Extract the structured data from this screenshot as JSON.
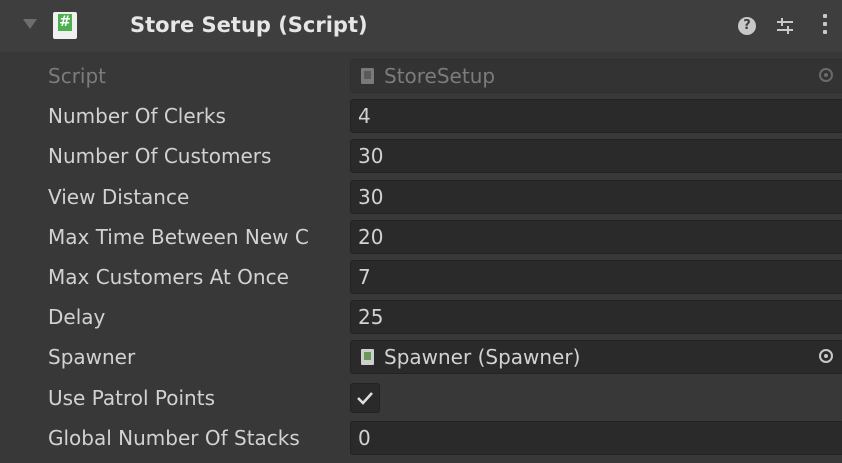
{
  "component": {
    "title": "Store Setup (Script)",
    "script_type_icon": "csharp-script-icon",
    "help_icon_glyph": "?"
  },
  "fields": [
    {
      "label": "Script",
      "value": "StoreSetup",
      "type": "object",
      "disabled": true
    },
    {
      "label": "Number Of Clerks",
      "value": "4",
      "type": "int"
    },
    {
      "label": "Number Of Customers",
      "value": "30",
      "type": "int"
    },
    {
      "label": "View Distance",
      "value": "30",
      "type": "int"
    },
    {
      "label": "Max Time Between New C",
      "value": "20",
      "type": "int"
    },
    {
      "label": "Max Customers At Once",
      "value": "7",
      "type": "int"
    },
    {
      "label": "Delay",
      "value": "25",
      "type": "int"
    },
    {
      "label": "Spawner",
      "value": "Spawner (Spawner)",
      "type": "object"
    },
    {
      "label": "Use Patrol Points",
      "checked": true,
      "type": "bool"
    },
    {
      "label": "Global Number Of Stacks",
      "value": "0",
      "type": "int"
    }
  ],
  "colors": {
    "background": "#383838",
    "header": "#3e3e3e",
    "field_bg": "#2a2a2a",
    "script_icon_green": "#4caf50"
  }
}
